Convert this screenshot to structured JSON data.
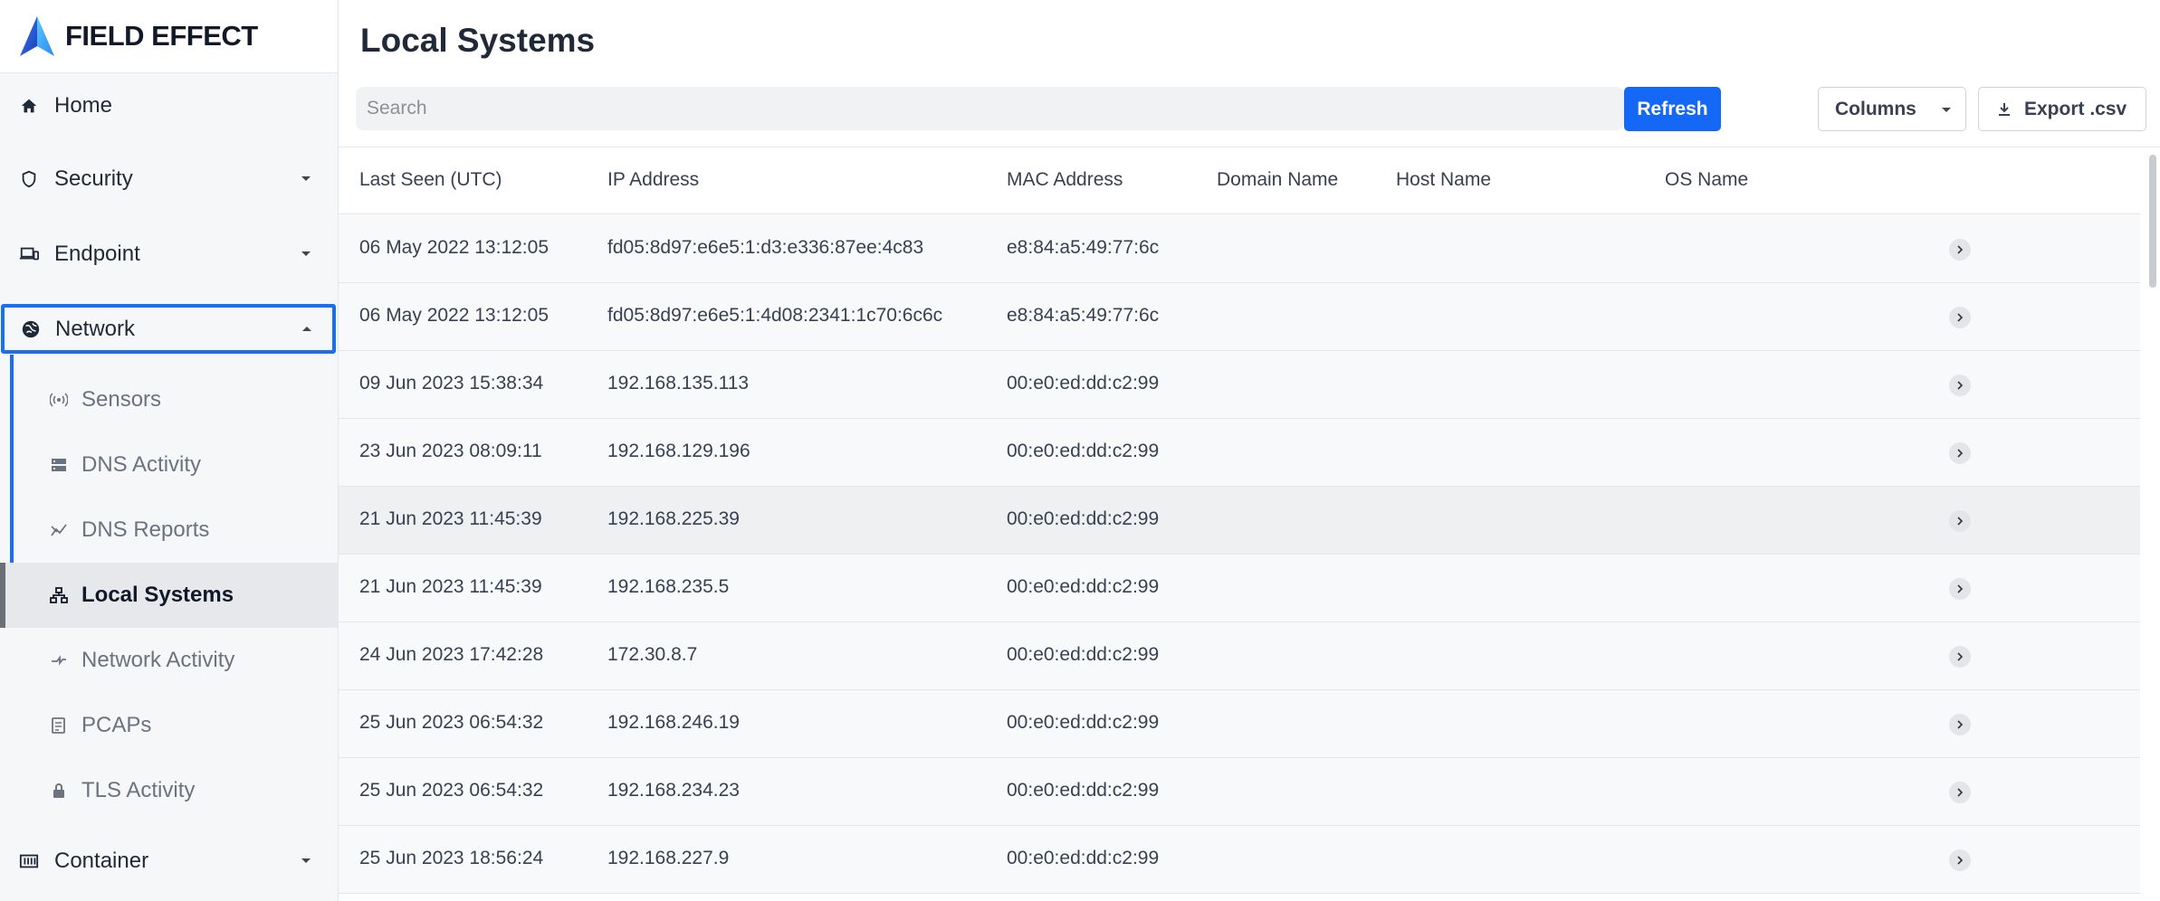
{
  "brand": {
    "name": "FIELD EFFECT"
  },
  "sidebar": {
    "items": [
      {
        "label": "Home",
        "icon": "home-icon"
      },
      {
        "label": "Security",
        "icon": "shield-icon"
      },
      {
        "label": "Endpoint",
        "icon": "devices-icon"
      },
      {
        "label": "Network",
        "icon": "globe-icon",
        "expanded": true
      },
      {
        "label": "Container",
        "icon": "container-icon"
      }
    ],
    "network_children": [
      {
        "label": "Sensors",
        "icon": "sensor-icon"
      },
      {
        "label": "DNS Activity",
        "icon": "dns-icon"
      },
      {
        "label": "DNS Reports",
        "icon": "report-icon"
      },
      {
        "label": "Local Systems",
        "icon": "local-systems-icon",
        "active": true
      },
      {
        "label": "Network Activity",
        "icon": "network-activity-icon"
      },
      {
        "label": "PCAPs",
        "icon": "pcap-icon"
      },
      {
        "label": "TLS Activity",
        "icon": "lock-icon"
      }
    ]
  },
  "page": {
    "title": "Local Systems"
  },
  "toolbar": {
    "search_placeholder": "Search",
    "refresh_label": "Refresh",
    "columns_label": "Columns",
    "export_label": "Export .csv"
  },
  "table": {
    "columns": [
      "Last Seen (UTC)",
      "IP Address",
      "MAC Address",
      "Domain Name",
      "Host Name",
      "OS Name"
    ],
    "rows": [
      {
        "last_seen": "06 May 2022 13:12:05",
        "ip": "fd05:8d97:e6e5:1:d3:e336:87ee:4c83",
        "mac": "e8:84:a5:49:77:6c",
        "domain": "",
        "host": "",
        "os": ""
      },
      {
        "last_seen": "06 May 2022 13:12:05",
        "ip": "fd05:8d97:e6e5:1:4d08:2341:1c70:6c6c",
        "mac": "e8:84:a5:49:77:6c",
        "domain": "",
        "host": "",
        "os": ""
      },
      {
        "last_seen": "09 Jun 2023 15:38:34",
        "ip": "192.168.135.113",
        "mac": "00:e0:ed:dd:c2:99",
        "domain": "",
        "host": "",
        "os": ""
      },
      {
        "last_seen": "23 Jun 2023 08:09:11",
        "ip": "192.168.129.196",
        "mac": "00:e0:ed:dd:c2:99",
        "domain": "",
        "host": "",
        "os": ""
      },
      {
        "last_seen": "21 Jun 2023 11:45:39",
        "ip": "192.168.225.39",
        "mac": "00:e0:ed:dd:c2:99",
        "domain": "",
        "host": "",
        "os": ""
      },
      {
        "last_seen": "21 Jun 2023 11:45:39",
        "ip": "192.168.235.5",
        "mac": "00:e0:ed:dd:c2:99",
        "domain": "",
        "host": "",
        "os": ""
      },
      {
        "last_seen": "24 Jun 2023 17:42:28",
        "ip": "172.30.8.7",
        "mac": "00:e0:ed:dd:c2:99",
        "domain": "",
        "host": "",
        "os": ""
      },
      {
        "last_seen": "25 Jun 2023 06:54:32",
        "ip": "192.168.246.19",
        "mac": "00:e0:ed:dd:c2:99",
        "domain": "",
        "host": "",
        "os": ""
      },
      {
        "last_seen": "25 Jun 2023 06:54:32",
        "ip": "192.168.234.23",
        "mac": "00:e0:ed:dd:c2:99",
        "domain": "",
        "host": "",
        "os": ""
      },
      {
        "last_seen": "25 Jun 2023 18:56:24",
        "ip": "192.168.227.9",
        "mac": "00:e0:ed:dd:c2:99",
        "domain": "",
        "host": "",
        "os": ""
      }
    ]
  },
  "colors": {
    "accent": "#1468f5",
    "highlight": "#1a6ef0"
  }
}
